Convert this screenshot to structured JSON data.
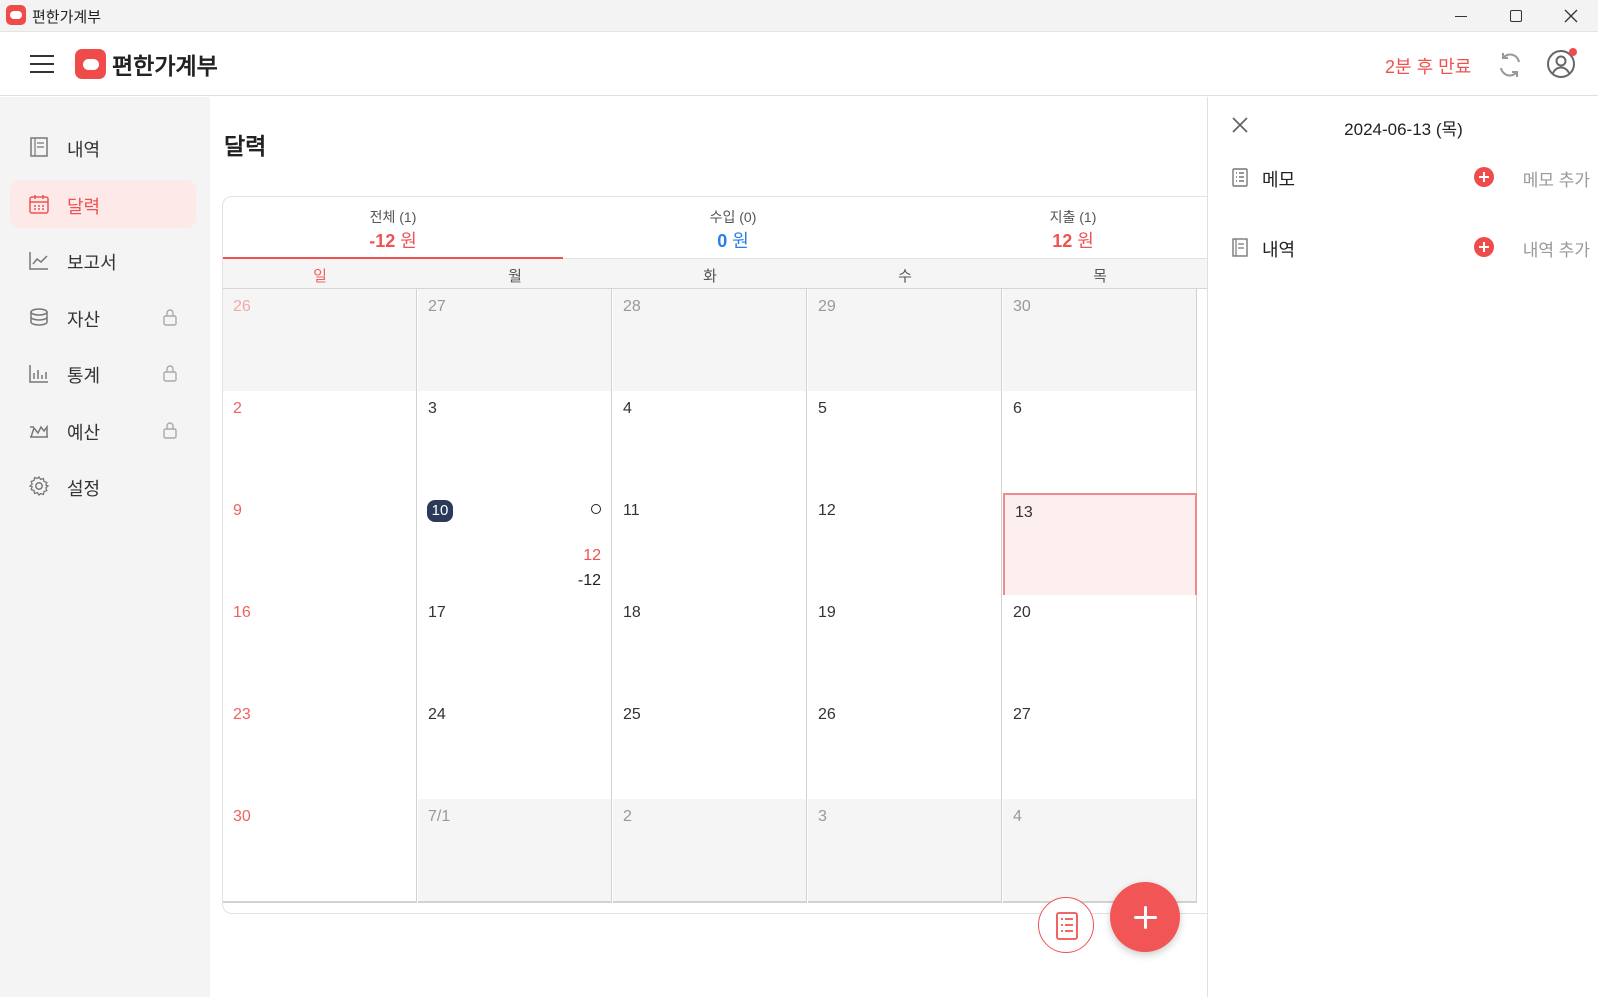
{
  "window": {
    "title": "편한가계부"
  },
  "header": {
    "brand": "편한가계부",
    "expire_text": "2분 후 만료"
  },
  "sidebar": {
    "items": [
      {
        "label": "내역",
        "icon": "book-icon",
        "locked": false,
        "active": false
      },
      {
        "label": "달력",
        "icon": "calendar-icon",
        "locked": false,
        "active": true
      },
      {
        "label": "보고서",
        "icon": "chart-line-icon",
        "locked": false,
        "active": false
      },
      {
        "label": "자산",
        "icon": "coins-icon",
        "locked": true,
        "active": false
      },
      {
        "label": "통계",
        "icon": "bar-chart-icon",
        "locked": true,
        "active": false
      },
      {
        "label": "예산",
        "icon": "budget-icon",
        "locked": true,
        "active": false
      },
      {
        "label": "설정",
        "icon": "gear-icon",
        "locked": false,
        "active": false
      }
    ]
  },
  "main": {
    "title": "달력",
    "tabs": [
      {
        "name": "전체 (1)",
        "value": "-12",
        "unit": " 원",
        "color": "#f05252"
      },
      {
        "name": "수입 (0)",
        "value": "0",
        "unit": " 원",
        "color": "#2b7de9"
      },
      {
        "name": "지출 (1)",
        "value": "12",
        "unit": " 원",
        "color": "#f05252"
      }
    ],
    "weekdays": [
      "일",
      "월",
      "화",
      "수",
      "목"
    ],
    "weeks": [
      [
        {
          "d": "26",
          "other": true
        },
        {
          "d": "27",
          "other": true
        },
        {
          "d": "28",
          "other": true
        },
        {
          "d": "29",
          "other": true
        },
        {
          "d": "30",
          "other": true
        }
      ],
      [
        {
          "d": "2"
        },
        {
          "d": "3"
        },
        {
          "d": "4"
        },
        {
          "d": "5"
        },
        {
          "d": "6"
        }
      ],
      [
        {
          "d": "9"
        },
        {
          "d": "10",
          "today": true,
          "marker": true,
          "expense": "12",
          "net": "-12"
        },
        {
          "d": "11"
        },
        {
          "d": "12"
        },
        {
          "d": "13",
          "selected": true
        }
      ],
      [
        {
          "d": "16"
        },
        {
          "d": "17"
        },
        {
          "d": "18"
        },
        {
          "d": "19"
        },
        {
          "d": "20"
        }
      ],
      [
        {
          "d": "23"
        },
        {
          "d": "24"
        },
        {
          "d": "25"
        },
        {
          "d": "26"
        },
        {
          "d": "27"
        }
      ],
      [
        {
          "d": "30"
        },
        {
          "d": "7/1",
          "other": true
        },
        {
          "d": "2",
          "other": true
        },
        {
          "d": "3",
          "other": true
        },
        {
          "d": "4",
          "other": true
        }
      ]
    ]
  },
  "right_panel": {
    "date": "2024-06-13 (목)",
    "memo_label": "메모",
    "memo_add": "메모 추가",
    "history_label": "내역",
    "history_add": "내역 추가"
  },
  "colors": {
    "accent": "#f05252",
    "income": "#2b7de9",
    "today_badge": "#2c3a5a"
  }
}
